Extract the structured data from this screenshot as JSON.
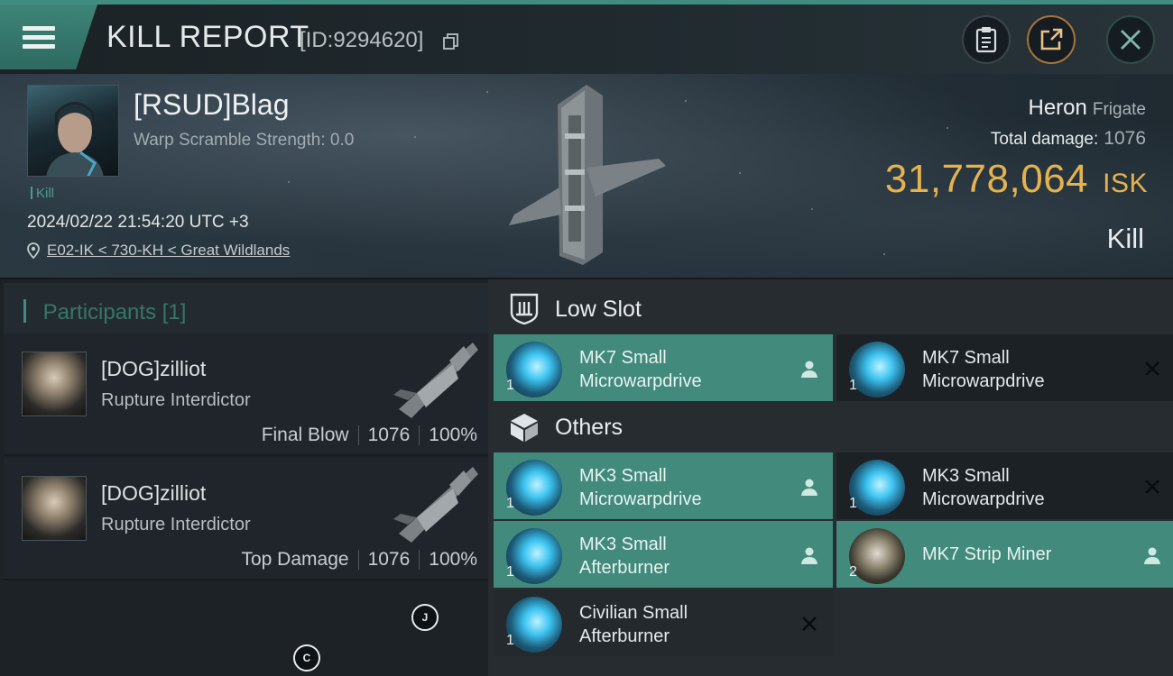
{
  "header": {
    "title": "KILL REPORT",
    "id": "[ID:9294620]"
  },
  "victim": {
    "name": "[RSUD]Blag",
    "warp_scramble": "Warp Scramble Strength: 0.0",
    "tag": "Kill",
    "datetime": "2024/02/22 21:54:20 UTC +3",
    "location": "E02-IK < 730-KH < Great Wildlands"
  },
  "ship": {
    "name": "Heron",
    "class": "Frigate",
    "total_damage_label": "Total damage:",
    "total_damage": "1076",
    "isk_value": "31,778,064",
    "isk_unit": "ISK",
    "result": "Kill"
  },
  "participants": {
    "title": "Participants",
    "count": "[1]",
    "rows": [
      {
        "name": "[DOG]zilliot",
        "ship": "Rupture Interdictor",
        "role": "Final Blow",
        "damage": "1076",
        "percent": "100%"
      },
      {
        "name": "[DOG]zilliot",
        "ship": "Rupture Interdictor",
        "role": "Top Damage",
        "damage": "1076",
        "percent": "100%"
      }
    ]
  },
  "sections": {
    "low_slot": "Low Slot",
    "others": "Others"
  },
  "modules": {
    "low_slot": [
      {
        "line1": "MK7 Small",
        "line2": "Microwarpdrive",
        "qty": "1",
        "status": "dropped",
        "icon": "microwarpdrive-icon"
      },
      {
        "line1": "MK7 Small",
        "line2": "Microwarpdrive",
        "qty": "1",
        "status": "destroyed",
        "icon": "microwarpdrive-icon"
      }
    ],
    "others": [
      {
        "line1": "MK3 Small",
        "line2": "Microwarpdrive",
        "qty": "1",
        "status": "dropped",
        "icon": "microwarpdrive-icon"
      },
      {
        "line1": "MK3 Small",
        "line2": "Microwarpdrive",
        "qty": "1",
        "status": "destroyed",
        "icon": "microwarpdrive-icon"
      },
      {
        "line1": "MK3 Small",
        "line2": "Afterburner",
        "qty": "1",
        "status": "dropped",
        "icon": "afterburner-icon"
      },
      {
        "line1": "MK7 Strip Miner",
        "line2": "",
        "qty": "2",
        "status": "dropped",
        "icon": "strip-miner-icon"
      },
      {
        "line1": "Civilian Small",
        "line2": "Afterburner",
        "qty": "1",
        "status": "destroyed",
        "icon": "afterburner-icon"
      }
    ]
  },
  "markers": [
    "J",
    "C"
  ],
  "colors": {
    "accent": "#3f8d80",
    "isk": "#e4b24f",
    "module_dropped": "#428a7c",
    "module_destroyed": "#1b2125"
  }
}
